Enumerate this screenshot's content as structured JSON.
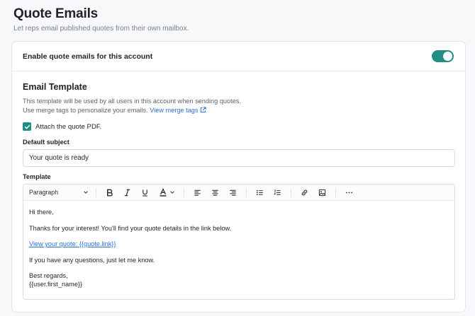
{
  "header": {
    "title": "Quote Emails",
    "subtitle": "Let reps email published quotes from their own mailbox."
  },
  "enable_row": {
    "label": "Enable quote emails for this account",
    "toggle_on": true
  },
  "template_section": {
    "title": "Email Template",
    "desc_line1": "This template will be used by all users in this account when sending quotes.",
    "desc_line2": "Use merge tags to personalize your emails.",
    "merge_link": "View merge tags",
    "attach_label": "Attach the quote PDF.",
    "attach_checked": true,
    "subject_label": "Default subject",
    "subject_value": "Your quote is ready",
    "template_label": "Template"
  },
  "toolbar": {
    "paragraph_select": "Paragraph",
    "icons": [
      "bold-icon",
      "italic-icon",
      "underline-icon",
      "text-color-icon",
      "align-left-icon",
      "align-center-icon",
      "align-right-icon",
      "bullet-list-icon",
      "numbered-list-icon",
      "link-icon",
      "image-icon",
      "more-icon"
    ]
  },
  "editor": {
    "greeting": "Hi there,",
    "body_line": "Thanks for your interest! You'll find your quote details in the link below.",
    "link_text": "View your quote: {{quote.link}}",
    "questions_line": "If you have any questions, just let me know.",
    "closing": "Best regards,",
    "signature": "{{user.first_name}}"
  },
  "colors": {
    "accent": "#1f8f86",
    "link": "#2a6fd6"
  }
}
